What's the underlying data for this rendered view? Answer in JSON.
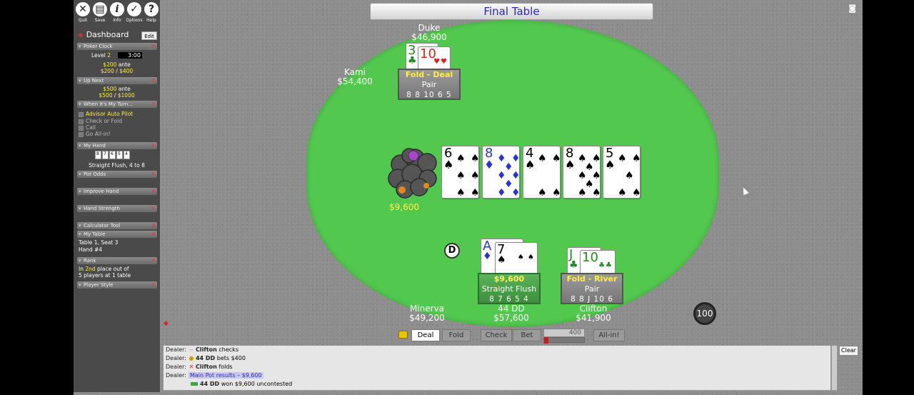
{
  "toolbar": [
    {
      "label": "Quit",
      "icon": "close-icon",
      "glyph": "✕"
    },
    {
      "label": "Save",
      "icon": "save-icon",
      "glyph": "▤"
    },
    {
      "label": "Info",
      "icon": "info-icon",
      "glyph": "i"
    },
    {
      "label": "Options",
      "icon": "options-check-icon",
      "glyph": "✓"
    },
    {
      "label": "Help",
      "icon": "help-icon",
      "glyph": "?"
    }
  ],
  "dashboard": {
    "title": "Dashboard",
    "edit": "Edit",
    "poker_clock": {
      "label": "Poker Clock",
      "level_label": "Level",
      "level": "2",
      "time": "3:00",
      "ante": "$200",
      "ante_word": "ante",
      "blinds_small": "$200",
      "blinds_big": "$400"
    },
    "up_next": {
      "label": "Up Next",
      "ante": "$500",
      "ante_word": "ante",
      "blinds_small": "$500",
      "blinds_big": "$1000"
    },
    "when_my_turn": {
      "label": "When It's My Turn...",
      "options": [
        "Advisor Auto Pilot",
        "Check or Fold",
        "Call",
        "Go All-in!"
      ]
    },
    "my_hand": {
      "label": "My Hand",
      "cards": [
        "8",
        "7",
        "6",
        "5",
        "4"
      ],
      "desc": "Straight Flush, 4 to 8"
    },
    "pot_odds": "Pot Odds",
    "improve_hand": "Improve Hand",
    "hand_strength": "Hand Strength",
    "calculator_tool": "Calculator Tool",
    "my_table": {
      "label": "My Table",
      "line1": "Table 1, Seat 3",
      "line2": "Hand #4"
    },
    "rank": {
      "label": "Rank",
      "line1_pre": "In",
      "place": "2nd",
      "line1_post": "place out of",
      "line2": "5 players at 1 table"
    },
    "player_style": "Player Style"
  },
  "table_title": "Final Table",
  "players": {
    "duke": {
      "name": "Duke",
      "chips": "$46,900",
      "status": "Fold - Deal",
      "hand": "Pair",
      "cards": "8 8 10 6 5"
    },
    "kami": {
      "name": "Kami",
      "chips": "$54,400"
    },
    "minerva": {
      "name": "Minerva",
      "chips": "$49,200"
    },
    "dd44": {
      "name": "44 DD",
      "chips": "$57,600",
      "status": "$9,600",
      "hand": "Straight Flush",
      "cards": "8 7 6 5 4"
    },
    "clifton": {
      "name": "Clifton",
      "chips": "$41,900",
      "status": "Fold - River",
      "hand": "Pair",
      "cards": "8 8 J 10 6"
    }
  },
  "hole_cards": {
    "duke": [
      {
        "rank": "3",
        "suit": "♣",
        "color": "green"
      },
      {
        "rank": "10",
        "suit": "♥",
        "color": "red"
      }
    ],
    "dd44": [
      {
        "rank": "A",
        "suit": "♦",
        "color": "blue"
      },
      {
        "rank": "7",
        "suit": "♠",
        "color": "black"
      }
    ],
    "clifton": [
      {
        "rank": "J",
        "suit": "♣",
        "color": "green"
      },
      {
        "rank": "10",
        "suit": "♣",
        "color": "green"
      }
    ]
  },
  "board": [
    {
      "rank": "6",
      "suit": "♠",
      "color": "black"
    },
    {
      "rank": "8",
      "suit": "♦",
      "color": "blue"
    },
    {
      "rank": "4",
      "suit": "♠",
      "color": "black"
    },
    {
      "rank": "8",
      "suit": "♠",
      "color": "black"
    },
    {
      "rank": "5",
      "suit": "♠",
      "color": "black"
    }
  ],
  "pot": "$9,600",
  "dealer_button": "D",
  "chip_stack_badge": "100",
  "controls": {
    "deal": "Deal",
    "fold": "Fold",
    "check": "Check",
    "bet": "Bet",
    "bet_amount": "400",
    "all_in": "All-in!"
  },
  "log": [
    {
      "who": "Dealer:",
      "icon": "~",
      "name": "Clifton",
      "text": "checks"
    },
    {
      "who": "Dealer:",
      "icon": "●",
      "name": "44 DD",
      "text": "bets $400"
    },
    {
      "who": "Dealer:",
      "icon": "✕",
      "name": "Clifton",
      "text": "folds"
    },
    {
      "who": "Dealer:",
      "highlight": "Main Pot results – $9,600"
    },
    {
      "who": "",
      "name": "44 DD",
      "text": "won $9,600 uncontested"
    }
  ],
  "clear": "Clear",
  "colors": {
    "felt": "#53c84f",
    "title_text": "#2a2ab4",
    "highlight_yellow": "#ffef3c"
  }
}
